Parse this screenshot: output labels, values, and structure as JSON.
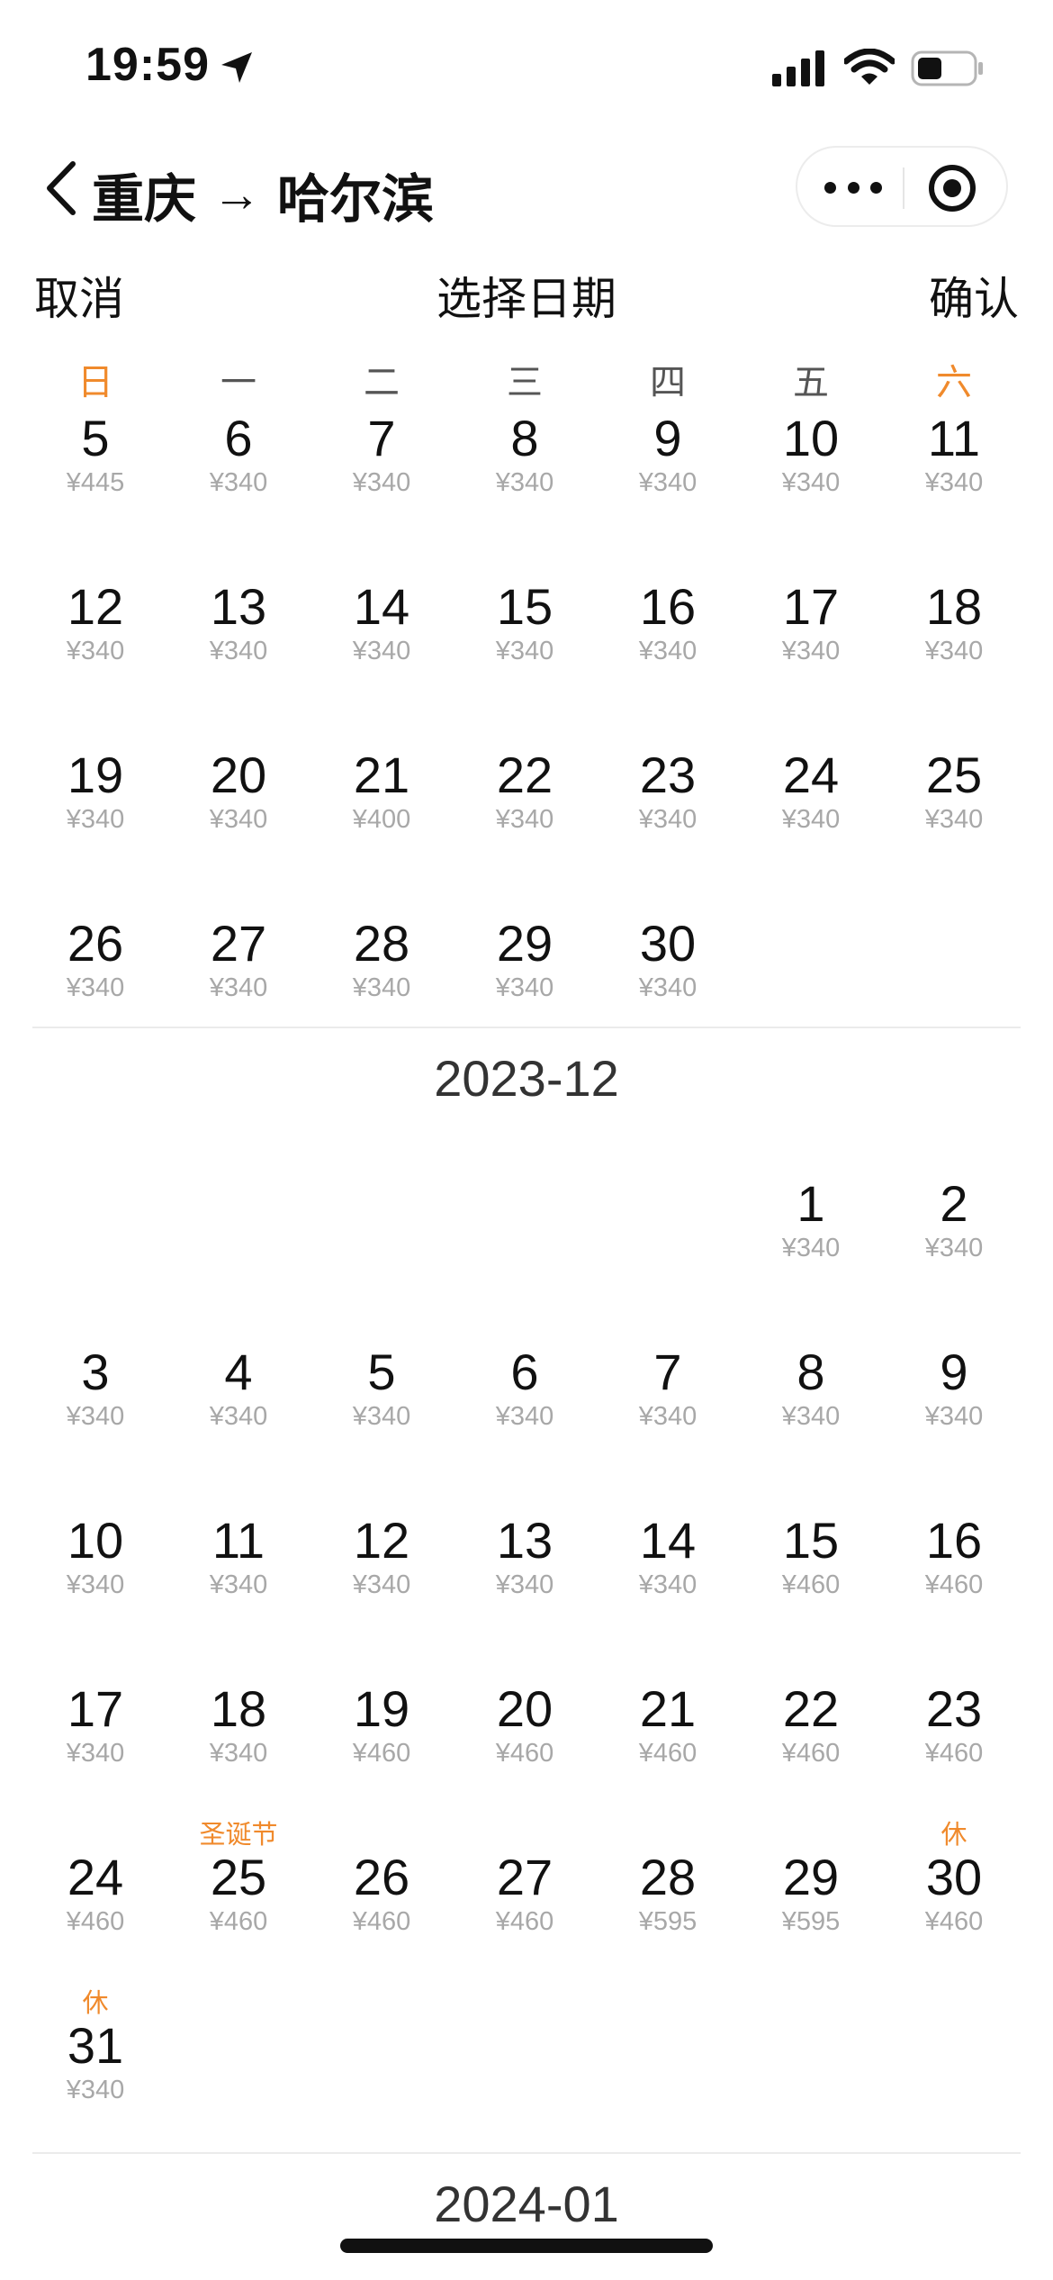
{
  "status_bar": {
    "time": "19:59",
    "icons": [
      "location-arrow-icon",
      "signal-icon",
      "wifi-icon",
      "battery-icon"
    ]
  },
  "nav": {
    "from": "重庆",
    "arrow": "→",
    "to": "哈尔滨",
    "back_icon": "chevron-left-icon",
    "more_icon": "more-dots-icon",
    "close_icon": "target-circle-icon"
  },
  "action_bar": {
    "cancel": "取消",
    "title": "选择日期",
    "confirm": "确认"
  },
  "weekdays": [
    "日",
    "一",
    "二",
    "三",
    "四",
    "五",
    "六"
  ],
  "colors": {
    "accent": "#f08a2c",
    "price": "#a8a8a8",
    "text": "#111111",
    "divider": "#ebebeb"
  },
  "months": [
    {
      "title": "",
      "first_weekday": 0,
      "days": [
        {
          "d": "5",
          "p": "¥445"
        },
        {
          "d": "6",
          "p": "¥340"
        },
        {
          "d": "7",
          "p": "¥340"
        },
        {
          "d": "8",
          "p": "¥340"
        },
        {
          "d": "9",
          "p": "¥340"
        },
        {
          "d": "10",
          "p": "¥340"
        },
        {
          "d": "11",
          "p": "¥340"
        },
        {
          "d": "12",
          "p": "¥340"
        },
        {
          "d": "13",
          "p": "¥340"
        },
        {
          "d": "14",
          "p": "¥340"
        },
        {
          "d": "15",
          "p": "¥340"
        },
        {
          "d": "16",
          "p": "¥340"
        },
        {
          "d": "17",
          "p": "¥340"
        },
        {
          "d": "18",
          "p": "¥340"
        },
        {
          "d": "19",
          "p": "¥340"
        },
        {
          "d": "20",
          "p": "¥340"
        },
        {
          "d": "21",
          "p": "¥400"
        },
        {
          "d": "22",
          "p": "¥340"
        },
        {
          "d": "23",
          "p": "¥340"
        },
        {
          "d": "24",
          "p": "¥340"
        },
        {
          "d": "25",
          "p": "¥340"
        },
        {
          "d": "26",
          "p": "¥340"
        },
        {
          "d": "27",
          "p": "¥340"
        },
        {
          "d": "28",
          "p": "¥340"
        },
        {
          "d": "29",
          "p": "¥340"
        },
        {
          "d": "30",
          "p": "¥340"
        }
      ]
    },
    {
      "title": "2023-12",
      "first_weekday": 5,
      "days": [
        {
          "d": "1",
          "p": "¥340"
        },
        {
          "d": "2",
          "p": "¥340"
        },
        {
          "d": "3",
          "p": "¥340"
        },
        {
          "d": "4",
          "p": "¥340"
        },
        {
          "d": "5",
          "p": "¥340"
        },
        {
          "d": "6",
          "p": "¥340"
        },
        {
          "d": "7",
          "p": "¥340"
        },
        {
          "d": "8",
          "p": "¥340"
        },
        {
          "d": "9",
          "p": "¥340"
        },
        {
          "d": "10",
          "p": "¥340"
        },
        {
          "d": "11",
          "p": "¥340"
        },
        {
          "d": "12",
          "p": "¥340"
        },
        {
          "d": "13",
          "p": "¥340"
        },
        {
          "d": "14",
          "p": "¥340"
        },
        {
          "d": "15",
          "p": "¥460"
        },
        {
          "d": "16",
          "p": "¥460"
        },
        {
          "d": "17",
          "p": "¥340"
        },
        {
          "d": "18",
          "p": "¥340"
        },
        {
          "d": "19",
          "p": "¥460"
        },
        {
          "d": "20",
          "p": "¥460"
        },
        {
          "d": "21",
          "p": "¥460"
        },
        {
          "d": "22",
          "p": "¥460"
        },
        {
          "d": "23",
          "p": "¥460"
        },
        {
          "d": "24",
          "p": "¥460"
        },
        {
          "d": "25",
          "p": "¥460",
          "tag": "圣诞节"
        },
        {
          "d": "26",
          "p": "¥460"
        },
        {
          "d": "27",
          "p": "¥460"
        },
        {
          "d": "28",
          "p": "¥595"
        },
        {
          "d": "29",
          "p": "¥595"
        },
        {
          "d": "30",
          "p": "¥460",
          "tag": "休"
        },
        {
          "d": "31",
          "p": "¥340",
          "tag": "休"
        }
      ]
    },
    {
      "title": "2024-01",
      "first_weekday": 1,
      "days": []
    }
  ]
}
